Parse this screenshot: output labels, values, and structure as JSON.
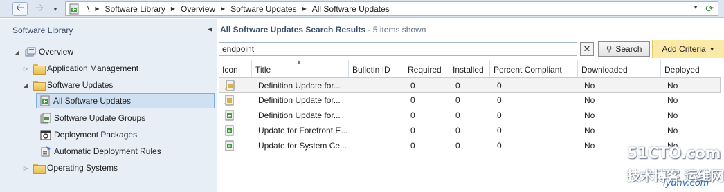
{
  "address_bar": {
    "breadcrumbs": [
      "\\",
      "Software Library",
      "Overview",
      "Software Updates",
      "All Software Updates"
    ]
  },
  "left_pane": {
    "title": "Software Library",
    "tree": [
      {
        "label": "Overview"
      },
      {
        "label": "Application Management"
      },
      {
        "label": "Software Updates"
      },
      {
        "label": "All Software Updates",
        "selected": true
      },
      {
        "label": "Software Update Groups"
      },
      {
        "label": "Deployment Packages"
      },
      {
        "label": "Automatic Deployment Rules"
      },
      {
        "label": "Operating Systems"
      }
    ]
  },
  "results": {
    "title": "All Software Updates Search Results",
    "count_text": "5 items shown",
    "search": {
      "value": "endpoint",
      "button_label": "Search",
      "add_criteria_label": "Add Criteria"
    },
    "columns": [
      "Icon",
      "Title",
      "Bulletin ID",
      "Required",
      "Installed",
      "Percent Compliant",
      "Downloaded",
      "Deployed"
    ],
    "rows": [
      {
        "icon": "update-deployed-icon",
        "title": "Definition Update for...",
        "bulletin": "",
        "required": "0",
        "installed": "0",
        "percent": "0",
        "downloaded": "No",
        "deployed": "No"
      },
      {
        "icon": "update-deployed-icon",
        "title": "Definition Update for...",
        "bulletin": "",
        "required": "0",
        "installed": "0",
        "percent": "0",
        "downloaded": "No",
        "deployed": "No"
      },
      {
        "icon": "update-icon",
        "title": "Definition Update for...",
        "bulletin": "",
        "required": "0",
        "installed": "0",
        "percent": "0",
        "downloaded": "No",
        "deployed": "No"
      },
      {
        "icon": "update-icon",
        "title": "Update for Forefront E...",
        "bulletin": "",
        "required": "0",
        "installed": "0",
        "percent": "0",
        "downloaded": "No",
        "deployed": "No"
      },
      {
        "icon": "update-icon",
        "title": "Update for System Ce...",
        "bulletin": "",
        "required": "0",
        "installed": "0",
        "percent": "0",
        "downloaded": "No",
        "deployed": "No"
      }
    ]
  },
  "watermark": {
    "line1": "51CTO.com",
    "line2": "技术博客 运维网",
    "line3": "iyunv.com"
  },
  "colors": {
    "pane_bg": "#e7eef6",
    "selection": "#cfe0f3",
    "add_criteria_bg": "#fbe9a8",
    "header_text": "#3b4f6b"
  }
}
